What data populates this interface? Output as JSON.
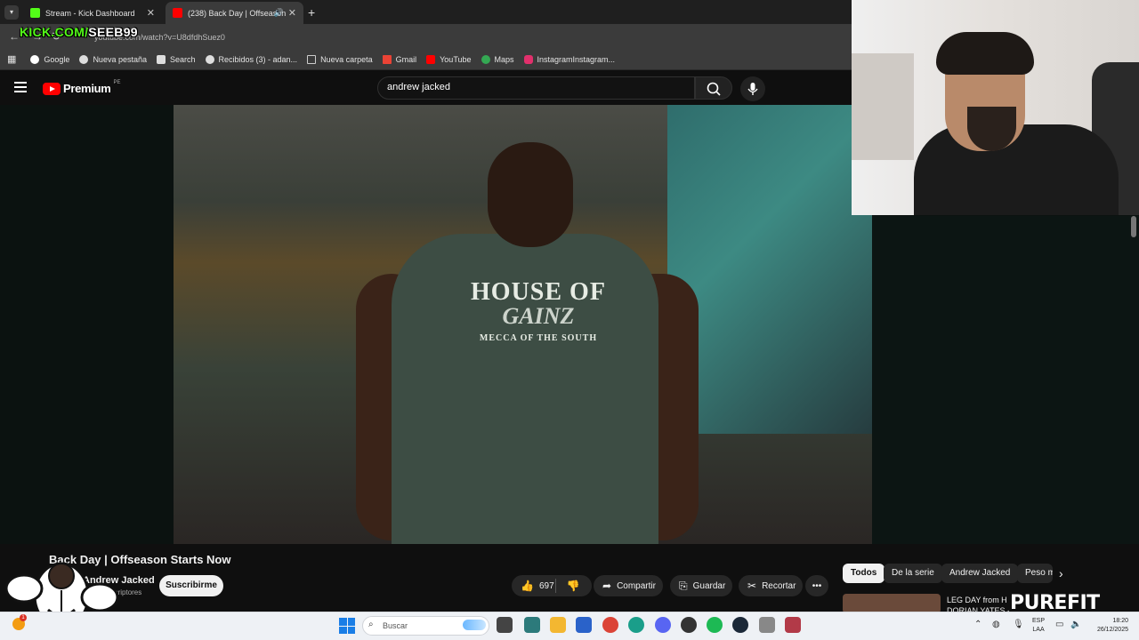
{
  "browser": {
    "tabs": [
      {
        "title": "Stream - Kick Dashboard",
        "favicon_color": "#53fc18",
        "active": false
      },
      {
        "title": "(238) Back Day | Offseason",
        "favicon_color": "#ff0000",
        "active": true
      }
    ],
    "new_tab": "+",
    "url": "youtube.com/watch?v=U8dfdhSuez0",
    "bookmarks": [
      {
        "label": "Google",
        "color": "#ffffff"
      },
      {
        "label": "Nueva pestaña",
        "color": "#ffffff"
      },
      {
        "label": "Search",
        "color": "#ffffff"
      },
      {
        "label": "Recibidos (3) - adan...",
        "color": "#ffffff"
      },
      {
        "label": "Nueva carpeta",
        "color": "#cccccc"
      },
      {
        "label": "Gmail",
        "color": "#ea4335"
      },
      {
        "label": "YouTube",
        "color": "#ff0000"
      },
      {
        "label": "Maps",
        "color": "#34a853"
      },
      {
        "label": "InstagramInstagram...",
        "color": "#e1306c"
      }
    ]
  },
  "stream_overlay": {
    "prefix": "KICK.COM/",
    "slug": "SEEB99"
  },
  "youtube": {
    "logo_text": "Premium",
    "region": "PE",
    "search_query": "andrew jacked",
    "video": {
      "shirt_lines": [
        "HOUSE OF",
        "GAINZ",
        "MECCA OF THE SOUTH"
      ],
      "title": "Back Day | Offseason Starts Now",
      "channel": "Andrew Jacked",
      "subscribers": "770 K suscriptores",
      "subscribe_label": "Suscribirme",
      "likes": "697",
      "share_label": "Compartir",
      "save_label": "Guardar",
      "clip_label": "Recortar",
      "more_label": "•••"
    },
    "chips": [
      "Todos",
      "De la serie",
      "Andrew Jacked",
      "Peso m"
    ],
    "recommendation": {
      "title_line1": "LEG DAY from H",
      "title_line2": "DORIAN YATES -"
    },
    "sponsor": "PUREFIT"
  },
  "taskbar": {
    "search_placeholder": "Buscar",
    "weather_badge": "1",
    "language": [
      "ESP",
      "LAA"
    ],
    "time": "18:20",
    "date": "26/12/2025",
    "apps": [
      {
        "name": "file-app",
        "color": "#444444"
      },
      {
        "name": "ai-app",
        "color": "#2c7a7b"
      },
      {
        "name": "folder-app",
        "color": "#f3b731"
      },
      {
        "name": "store-app",
        "color": "#2a62c9"
      },
      {
        "name": "chrome-app",
        "color": "#db4437"
      },
      {
        "name": "edge-app",
        "color": "#1a9e8a"
      },
      {
        "name": "discord-app",
        "color": "#5865f2"
      },
      {
        "name": "obs-app",
        "color": "#333333"
      },
      {
        "name": "spotify-app",
        "color": "#1db954"
      },
      {
        "name": "steam-app",
        "color": "#1b2838"
      },
      {
        "name": "misc-app",
        "color": "#888888"
      },
      {
        "name": "record-app",
        "color": "#b23a48"
      }
    ]
  }
}
